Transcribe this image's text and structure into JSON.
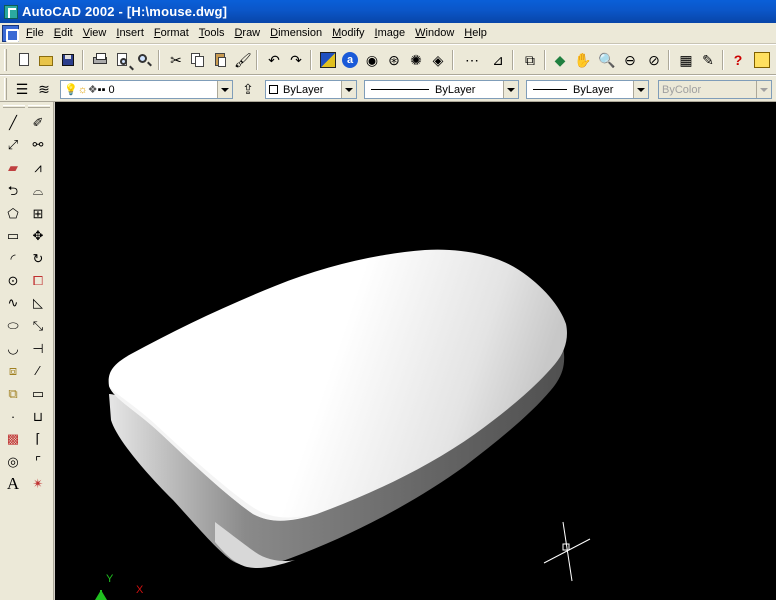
{
  "window": {
    "title": "AutoCAD 2002 - [H:\\mouse.dwg]"
  },
  "menu": [
    "File",
    "Edit",
    "View",
    "Insert",
    "Format",
    "Tools",
    "Draw",
    "Dimension",
    "Modify",
    "Image",
    "Window",
    "Help"
  ],
  "properties_toolbar": {
    "layer_value": "0",
    "color_value": "ByLayer",
    "linetype_value": "ByLayer",
    "lineweight_value": "ByLayer",
    "plotstyle_value": "ByColor"
  },
  "draw_tools": [
    "line",
    "construction-line",
    "polyline",
    "polygon",
    "rectangle",
    "arc",
    "circle",
    "spline",
    "ellipse",
    "ellipse-arc",
    "insert-block",
    "make-block",
    "point",
    "hatch",
    "region",
    "multiline-text"
  ],
  "modify_tools": [
    "erase",
    "copy",
    "mirror",
    "offset",
    "array",
    "move",
    "rotate",
    "scale",
    "stretch",
    "trim",
    "extend",
    "break",
    "chamfer",
    "fillet",
    "explode"
  ],
  "canvas": {
    "background": "#000000",
    "ucs_x_label": "X",
    "ucs_y_label": "Y",
    "model": "3D rendered computer mouse body"
  },
  "colors": {
    "titlebar": "#0a5fd8",
    "toolbar_bg": "#ece9d8",
    "x_axis": "#d01010",
    "y_axis": "#20c020"
  }
}
